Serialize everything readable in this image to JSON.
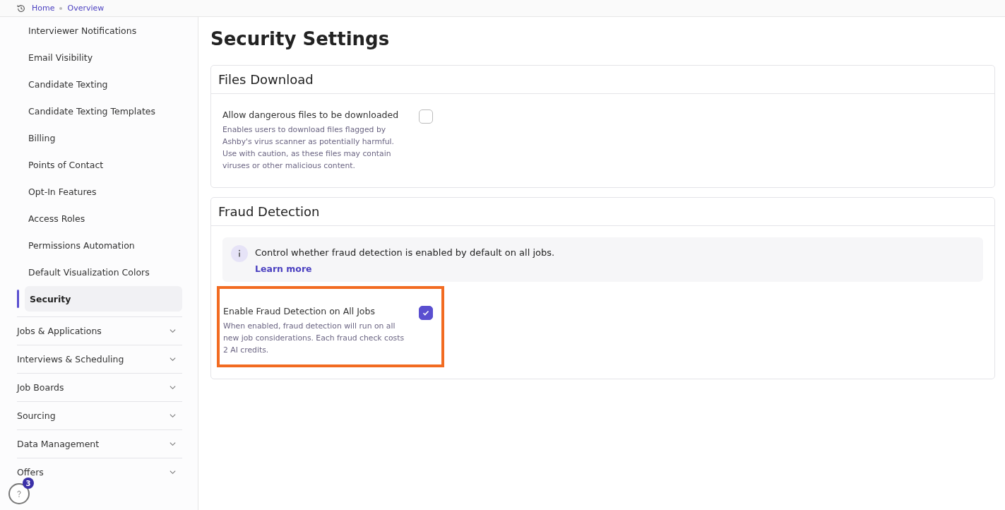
{
  "breadcrumbs": [
    {
      "label": "Home"
    },
    {
      "label": "Overview"
    }
  ],
  "sidebar": {
    "items": [
      {
        "label": "Interviewer Notifications",
        "selected": false
      },
      {
        "label": "Email Visibility",
        "selected": false
      },
      {
        "label": "Candidate Texting",
        "selected": false
      },
      {
        "label": "Candidate Texting Templates",
        "selected": false
      },
      {
        "label": "Billing",
        "selected": false
      },
      {
        "label": "Points of Contact",
        "selected": false
      },
      {
        "label": "Opt-In Features",
        "selected": false
      },
      {
        "label": "Access Roles",
        "selected": false
      },
      {
        "label": "Permissions Automation",
        "selected": false
      },
      {
        "label": "Default Visualization Colors",
        "selected": false
      },
      {
        "label": "Security",
        "selected": true
      }
    ],
    "groups": [
      {
        "label": "Jobs & Applications",
        "expanded": false
      },
      {
        "label": "Interviews & Scheduling",
        "expanded": false
      },
      {
        "label": "Job Boards",
        "expanded": false
      },
      {
        "label": "Sourcing",
        "expanded": false
      },
      {
        "label": "Data Management",
        "expanded": false
      },
      {
        "label": "Offers",
        "expanded": false
      }
    ]
  },
  "help": {
    "badge": "3"
  },
  "page_title": "Security Settings",
  "sections": [
    {
      "title": "Files Download",
      "settings": [
        {
          "label": "Allow dangerous files to be downloaded",
          "description": "Enables users to download files flagged by Ashby's virus scanner as potentially harmful. Use with caution, as these files may contain viruses or other malicious content.",
          "checked": false,
          "highlighted": false
        }
      ]
    },
    {
      "title": "Fraud Detection",
      "info": {
        "text": "Control whether fraud detection is enabled by default on all jobs.",
        "link": "Learn more"
      },
      "settings": [
        {
          "label": "Enable Fraud Detection on All Jobs",
          "description": "When enabled, fraud detection will run on all new job considerations. Each fraud check costs 2 AI credits.",
          "checked": true,
          "highlighted": true
        }
      ]
    }
  ]
}
